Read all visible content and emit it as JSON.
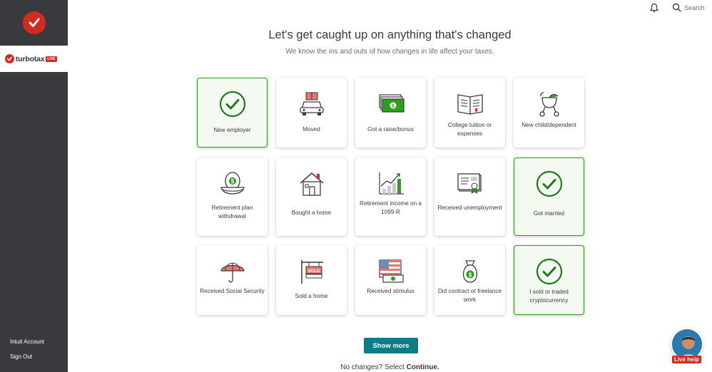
{
  "sidebar": {
    "brand": "turbotax",
    "brand_tag": "LIVE",
    "links": [
      "Intuit Account",
      "Sign Out"
    ]
  },
  "topbar": {
    "search_label": "Search"
  },
  "page": {
    "title": "Let's get caught up on anything that's changed",
    "subtitle": "We know the ins and outs of how changes in life affect your taxes."
  },
  "cards": [
    {
      "label": "New employer",
      "icon": "check-circle-icon",
      "selected": true
    },
    {
      "label": "Moved",
      "icon": "moving-car-icon",
      "selected": false
    },
    {
      "label": "Got a raise/bonus",
      "icon": "cash-stack-icon",
      "selected": false
    },
    {
      "label": "College tuition or expenses",
      "icon": "book-icon",
      "selected": false
    },
    {
      "label": "New child/dependent",
      "icon": "stroller-icon",
      "selected": false
    },
    {
      "label": "Retirement plan withdrawal",
      "icon": "nest-egg-icon",
      "selected": false
    },
    {
      "label": "Bought a home",
      "icon": "house-icon",
      "selected": false
    },
    {
      "label": "Retirement income on a 1099-R",
      "icon": "growth-chart-icon",
      "selected": false
    },
    {
      "label": "Received unemployment",
      "icon": "check-document-icon",
      "selected": false
    },
    {
      "label": "Got married",
      "icon": "check-circle-icon",
      "selected": true
    },
    {
      "label": "Received Social Security",
      "icon": "umbrella-icon",
      "selected": false
    },
    {
      "label": "Sold a home",
      "icon": "sold-sign-icon",
      "selected": false
    },
    {
      "label": "Received stimulus",
      "icon": "flag-money-icon",
      "selected": false
    },
    {
      "label": "Did contract or freelance work",
      "icon": "money-bag-icon",
      "selected": false
    },
    {
      "label": "I sold or traded cryptocurrency",
      "icon": "check-circle-icon",
      "selected": true
    }
  ],
  "actions": {
    "show_more": "Show more",
    "footer_prefix": "No changes? Select ",
    "footer_bold": "Continue."
  },
  "live_help": {
    "label": "Live help"
  },
  "colors": {
    "sidebar": "#393a3d",
    "brand_red": "#d52b1e",
    "selected_green": "#2ca01c",
    "button_teal": "#0e7c86"
  }
}
